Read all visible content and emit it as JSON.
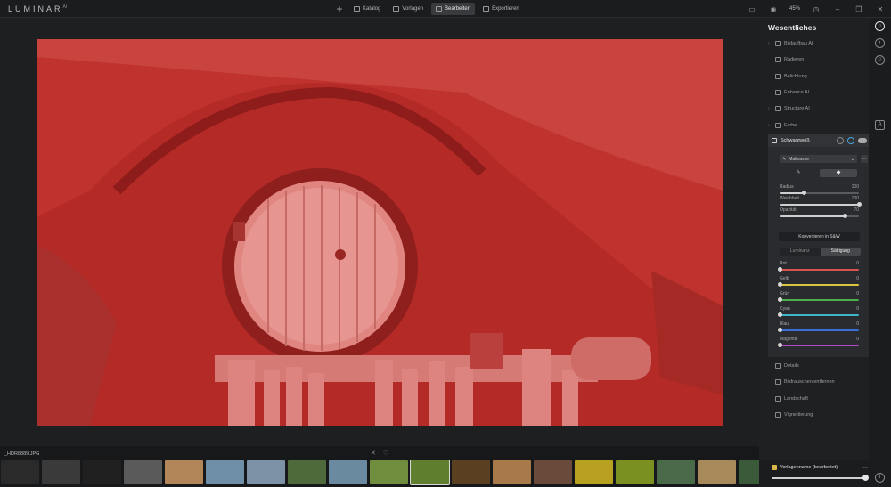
{
  "app": {
    "logo": "LUMINAR",
    "logo_version": "AI"
  },
  "nav": [
    {
      "label": "Katalog",
      "active": false
    },
    {
      "label": "Vorlagen",
      "active": false
    },
    {
      "label": "Bearbeiten",
      "active": true
    },
    {
      "label": "Exportieren",
      "active": false
    }
  ],
  "top_right": {
    "zoom": "45%"
  },
  "sidebar": {
    "title": "Wesentliches",
    "tools_top": [
      {
        "label": "Bildaufbau AI",
        "chev": true
      },
      {
        "label": "Radieren",
        "chev": false
      },
      {
        "label": "Belichtung",
        "chev": false
      },
      {
        "label": "Enhance AI",
        "chev": false
      },
      {
        "label": "Structure AI",
        "chev": true
      },
      {
        "label": "Farbe",
        "chev": true
      }
    ],
    "bw": {
      "title": "Schwarzweiß",
      "mask_label": "Malmaske",
      "mask_more": "...",
      "sliders": [
        {
          "label": "Radius",
          "value": 100,
          "fraction": 0.3
        },
        {
          "label": "Weichheit",
          "value": 100,
          "fraction": 1.0
        },
        {
          "label": "Opazität",
          "value": 70,
          "fraction": 0.82
        }
      ],
      "convert_label": "Konvertieren in S&W",
      "segments": [
        {
          "label": "Luminanz",
          "active": false
        },
        {
          "label": "Sättigung",
          "active": true
        }
      ],
      "color_sliders": [
        {
          "label": "Rot",
          "value": 0,
          "color": "#d9534f"
        },
        {
          "label": "Gelb",
          "value": 0,
          "color": "#d8c640"
        },
        {
          "label": "Grün",
          "value": 0,
          "color": "#4ab04a"
        },
        {
          "label": "Cyan",
          "value": 0,
          "color": "#3fb6c8"
        },
        {
          "label": "Blau",
          "value": 0,
          "color": "#3a6fd8"
        },
        {
          "label": "Magenta",
          "value": 0,
          "color": "#b04ac8"
        }
      ]
    },
    "tools_bottom": [
      {
        "label": "Details"
      },
      {
        "label": "Bildrauschen entfernen"
      },
      {
        "label": "Landschaft"
      },
      {
        "label": "Vignettierung"
      }
    ]
  },
  "filmstrip": {
    "filename": "_HDR8889.JPG",
    "thumbs": [
      {
        "color": "#2a2a2a",
        "selected": false
      },
      {
        "color": "#3a3a3a",
        "selected": false
      },
      {
        "color": "#202020",
        "selected": false
      },
      {
        "color": "#5a5a5a",
        "selected": false
      },
      {
        "color": "#b3865a",
        "selected": false
      },
      {
        "color": "#6f8fa8",
        "selected": false
      },
      {
        "color": "#7c90a6",
        "selected": false
      },
      {
        "color": "#4f6a3a",
        "selected": false
      },
      {
        "color": "#6a8aa0",
        "selected": false
      },
      {
        "color": "#6f8d3c",
        "selected": false
      },
      {
        "color": "#5f7f2f",
        "selected": true
      },
      {
        "color": "#5a4020",
        "selected": false
      },
      {
        "color": "#a87a4a",
        "selected": false
      },
      {
        "color": "#6a4a3a",
        "selected": false
      },
      {
        "color": "#b8a020",
        "selected": false
      },
      {
        "color": "#7a9020",
        "selected": false
      },
      {
        "color": "#4a6a4a",
        "selected": false
      },
      {
        "color": "#a88a5a",
        "selected": false
      },
      {
        "color": "#3a5a3a",
        "selected": false
      },
      {
        "color": "#2a2a2a",
        "selected": false
      }
    ]
  },
  "preset": {
    "name": "Vorlagenname (bearbeitet)",
    "more": "..."
  }
}
